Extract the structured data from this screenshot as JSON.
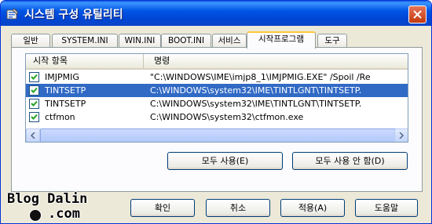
{
  "window": {
    "title": "시스템 구성 유틸리티",
    "close_symbol": "close-icon"
  },
  "tabs": [
    {
      "label": "일반"
    },
    {
      "label": "SYSTEM.INI"
    },
    {
      "label": "WIN.INI"
    },
    {
      "label": "BOOT.INI"
    },
    {
      "label": "서비스"
    },
    {
      "label": "시작프로그램",
      "active": true
    },
    {
      "label": "도구"
    }
  ],
  "startup_list": {
    "headers": {
      "item": "시작 항목",
      "command": "명령"
    },
    "rows": [
      {
        "name": "IMJPMIG",
        "command": "\"C:\\WINDOWS\\IME\\imjp8_1\\IMJPMIG.EXE\" /Spoil /Re",
        "checked": true,
        "selected": false
      },
      {
        "name": "TINTSETP",
        "command": "C:\\WINDOWS\\system32\\IME\\TINTLGNT\\TINTSETP.",
        "checked": true,
        "selected": true
      },
      {
        "name": "TINTSETP",
        "command": "C:\\WINDOWS\\system32\\IME\\TINTLGNT\\TINTSETP.",
        "checked": true,
        "selected": false
      },
      {
        "name": "ctfmon",
        "command": "C:\\WINDOWS\\system32\\ctfmon.exe",
        "checked": true,
        "selected": false
      }
    ]
  },
  "buttons": {
    "enable_all": "모두 사용(E)",
    "disable_all": "모두 사용 안 함(D)",
    "ok": "확인",
    "cancel": "취소",
    "apply": "적용(A)",
    "help": "도움말"
  },
  "watermark": {
    "line1": "Blog Dalin",
    "line2": ".com"
  },
  "colors": {
    "title_bar": "#0054e3",
    "selection": "#316ac5",
    "close_button": "#c3380c",
    "active_tab_accent": "#ffc83c"
  }
}
